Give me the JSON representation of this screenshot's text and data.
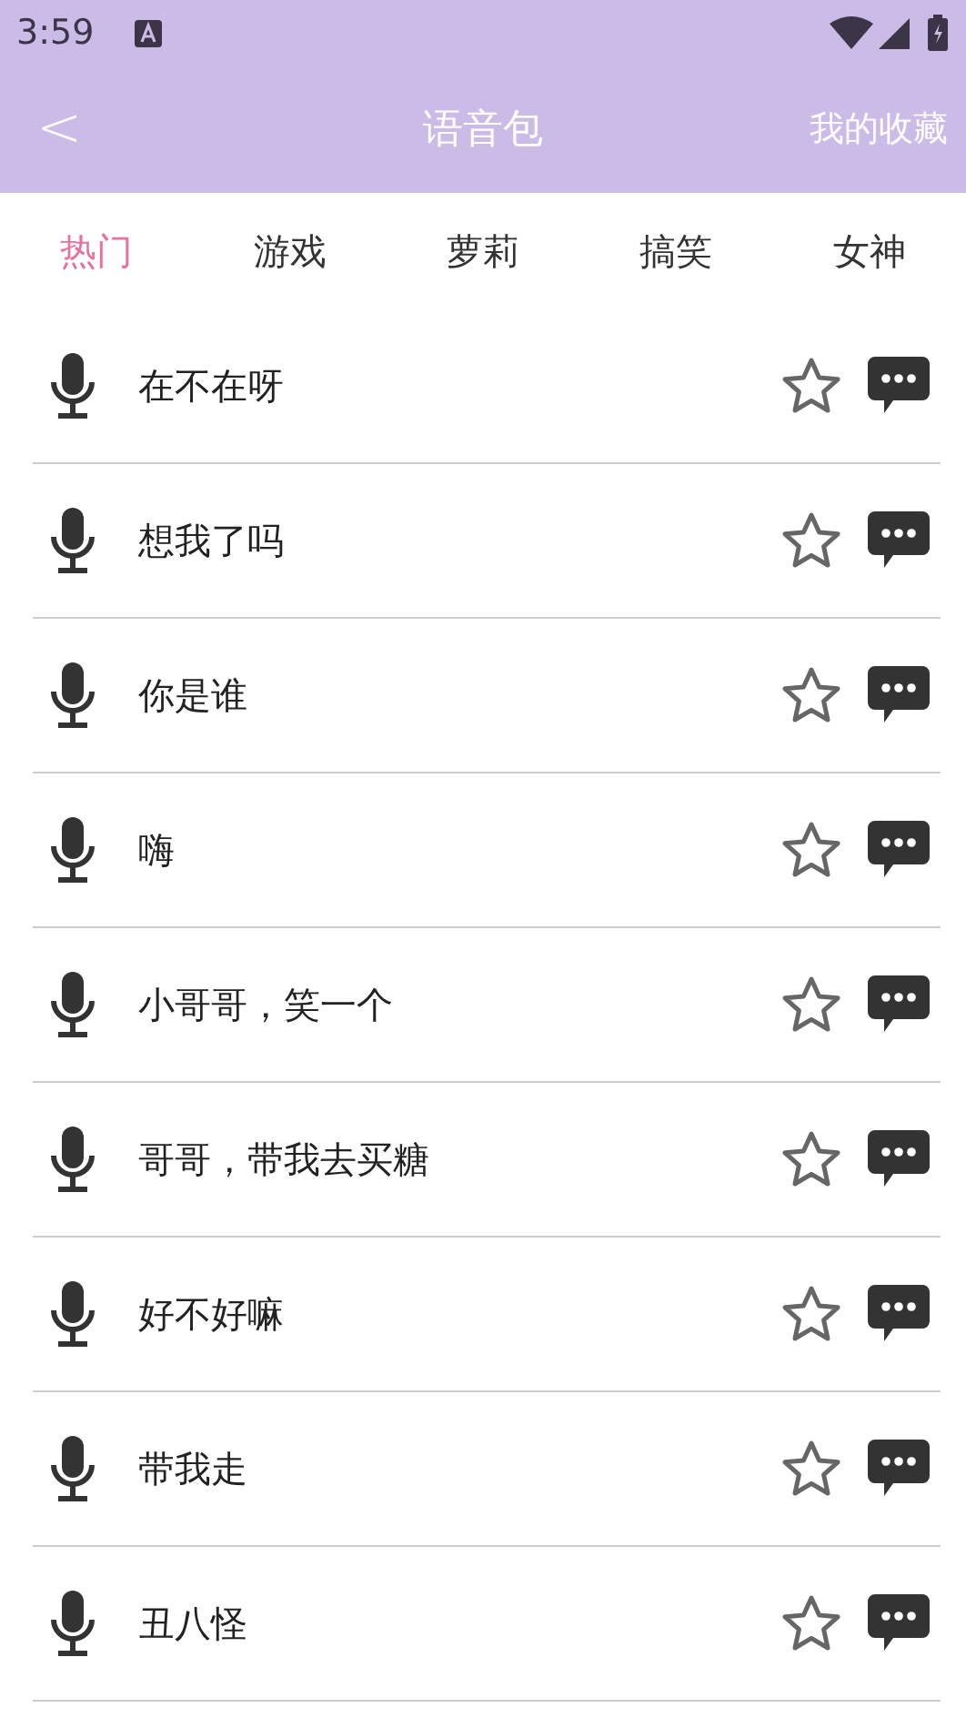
{
  "status_bar": {
    "time": "3:59"
  },
  "header": {
    "back": "<",
    "title": "语音包",
    "action": "我的收藏"
  },
  "tabs": [
    {
      "label": "热门",
      "selected": true
    },
    {
      "label": "游戏",
      "selected": false
    },
    {
      "label": "萝莉",
      "selected": false
    },
    {
      "label": "搞笑",
      "selected": false
    },
    {
      "label": "女神",
      "selected": false
    }
  ],
  "voices": [
    {
      "text": "在不在呀",
      "favorited": false
    },
    {
      "text": "想我了吗",
      "favorited": false
    },
    {
      "text": "你是谁",
      "favorited": false
    },
    {
      "text": "嗨",
      "favorited": false
    },
    {
      "text": "小哥哥，笑一个",
      "favorited": false
    },
    {
      "text": "哥哥，带我去买糖",
      "favorited": false
    },
    {
      "text": "好不好嘛",
      "favorited": false
    },
    {
      "text": "带我走",
      "favorited": false
    },
    {
      "text": "丑八怪",
      "favorited": false
    }
  ]
}
